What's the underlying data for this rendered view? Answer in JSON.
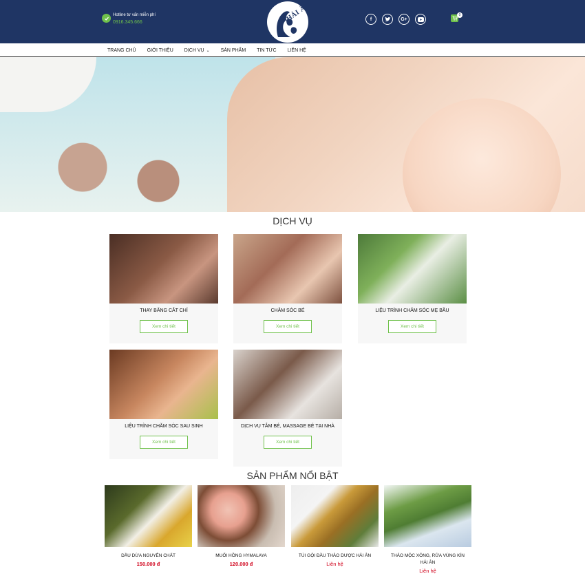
{
  "header": {
    "hotline_label": "Hotline tư vấn miễn phí",
    "hotline_number": "0916.345.666",
    "logo_text": "HẢI ÂN",
    "socials": [
      "facebook-icon",
      "twitter-icon",
      "google-plus-icon",
      "youtube-icon"
    ],
    "cart_count": "0"
  },
  "nav": {
    "items": [
      {
        "label": "TRANG CHỦ"
      },
      {
        "label": "GIỚI THIỆU"
      },
      {
        "label": "DỊCH VỤ",
        "caret": "⌄"
      },
      {
        "label": "SẢN PHẨM"
      },
      {
        "label": "TIN TỨC"
      },
      {
        "label": "LIÊN HỆ"
      }
    ]
  },
  "services": {
    "title": "DỊCH VỤ",
    "button_label": "Xem chi tiết",
    "items": [
      {
        "name": "THAY BĂNG CẮT CHỈ"
      },
      {
        "name": "CHĂM SÓC BÉ"
      },
      {
        "name": "LIỆU TRÌNH CHĂM SÓC MẸ BẦU"
      },
      {
        "name": "LIỆU TRÌNH CHĂM SÓC SAU SINH"
      },
      {
        "name": "DỊCH VỤ TẮM BÉ, MASSAGE BÉ TẠI NHÀ"
      }
    ]
  },
  "products": {
    "title": "SẢN PHẨM NỔI BẬT",
    "items": [
      {
        "name": "DẦU DỪA NGUYÊN CHẤT",
        "price": "150.000 đ"
      },
      {
        "name": "MUỐI HỒNG HYMALAYA",
        "price": "120.000 đ"
      },
      {
        "name": "TÚI GỘI ĐẦU THẢO DƯỢC HẢI ÂN",
        "price": "Liên hệ"
      },
      {
        "name": "THẢO MỘC XÔNG, RỬA VÙNG KÍN HẢI ÂN",
        "price": "Liên hệ"
      }
    ]
  },
  "colors": {
    "header_bg": "#1f3564",
    "accent_green": "#6fc14b",
    "price_red": "#d0021b"
  }
}
